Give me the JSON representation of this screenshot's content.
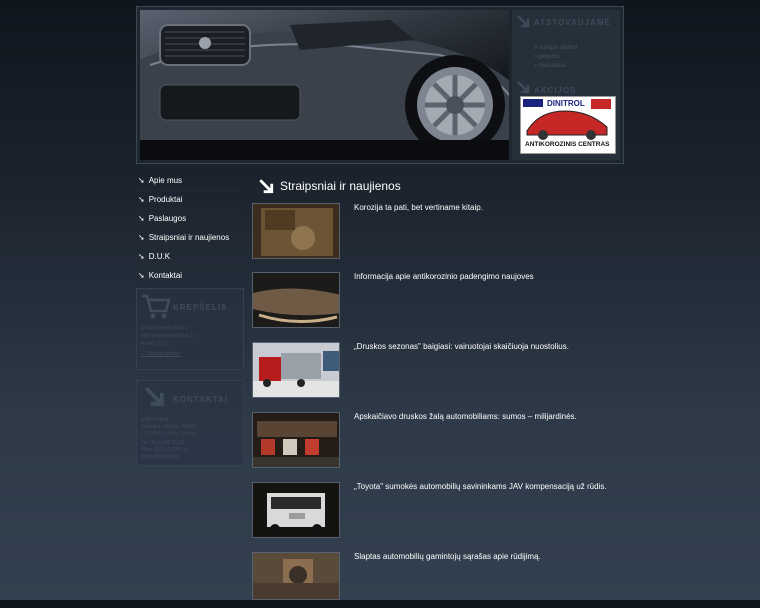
{
  "sidebar_top": {
    "atstovaujame_title": "ATSTOVAUJAME",
    "atstovaujame_items": [
      "europe dinitrol",
      "pelytrus",
      "mecaltess"
    ],
    "akcijos_title": "AKCIJOS",
    "logo_brand": "DINITROL",
    "logo_caption": "ANTIKOROZINIS CENTRAS"
  },
  "menu": [
    {
      "label": "Apie mus"
    },
    {
      "label": "Produktai"
    },
    {
      "label": "Paslaugos"
    },
    {
      "label": "Straipsniai ir naujienos"
    },
    {
      "label": "D.U.K"
    },
    {
      "label": "Kontaktai"
    }
  ],
  "cart": {
    "title": "KREPŠELIS",
    "line1": "Dinitrol prekių pirkti 3",
    "line2": "Viso prekių krepšelyje 0",
    "line3": "Iš viso: 0 Lt",
    "link": "» Užsakyti prekes"
  },
  "contacts": {
    "title": "KONTAKTAI",
    "lines": [
      "UAB Dinitrol",
      "Zarasų 4, Vilnius, 05183",
      "LT-10106 Vilnius, Lietuva",
      "Tel: (8-5) 259 59 10",
      "Faks: (8-5) 259 59 17",
      "dinitrol@dinitrol.lt"
    ]
  },
  "main": {
    "title": "Straipsniai ir naujienos",
    "news": [
      {
        "text": "Korozija ta pati, bet vertiname kitaip."
      },
      {
        "text": "Informacija apie antikorozinio padengimo naujoves"
      },
      {
        "text": "„Druskos sezonas\" baigiasi: vairuotojai skaičiuoja nuostolius."
      },
      {
        "text": "Apskaičiavo druskos žalą automobiliams: sumos – milijardinės."
      },
      {
        "text": "„Toyota\" sumokės automobilių savininkams JAV kompensaciją už rūdis."
      },
      {
        "text": "Slaptas automobilių gamintojų sąrašas apie rūdijimą."
      }
    ]
  }
}
